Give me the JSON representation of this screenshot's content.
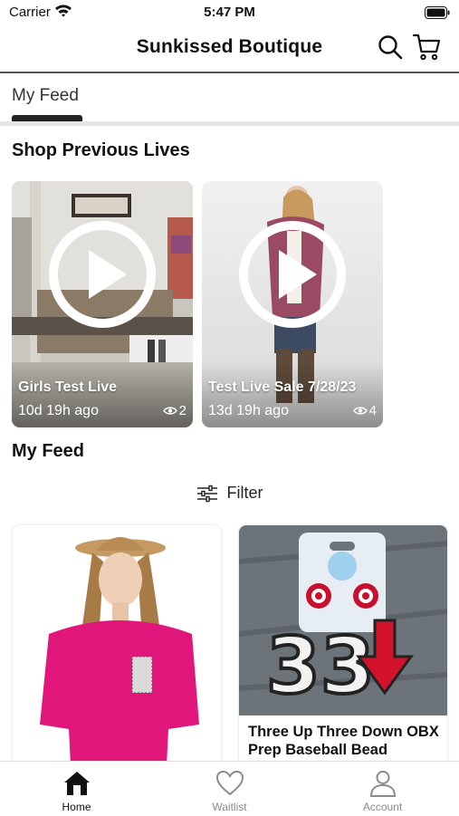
{
  "status": {
    "carrier": "Carrier",
    "time": "5:47 PM"
  },
  "header": {
    "title": "Sunkissed Boutique",
    "icons": [
      "search-icon",
      "cart-icon"
    ]
  },
  "tabs": [
    {
      "label": "My Feed",
      "active": true
    }
  ],
  "previous_lives": {
    "title": "Shop Previous Lives",
    "items": [
      {
        "name": "Girls Test Live",
        "ago": "10d 19h ago",
        "views": "2"
      },
      {
        "name": "Test Live Sale 7/28/23",
        "ago": "13d 19h ago",
        "views": "4"
      }
    ]
  },
  "feed": {
    "title": "My Feed",
    "filter_label": "Filter",
    "products": [
      {
        "title": ""
      },
      {
        "title": "Three Up Three Down OBX Prep Baseball Bead"
      }
    ]
  },
  "bottom_nav": [
    {
      "label": "Home",
      "active": true,
      "icon": "home-icon"
    },
    {
      "label": "Waitlist",
      "active": false,
      "icon": "heart-icon"
    },
    {
      "label": "Account",
      "active": false,
      "icon": "account-icon"
    }
  ],
  "colors": {
    "active_nav": "#111111",
    "inactive_nav": "#8a8a8a",
    "pink_top": "#e0167a"
  }
}
